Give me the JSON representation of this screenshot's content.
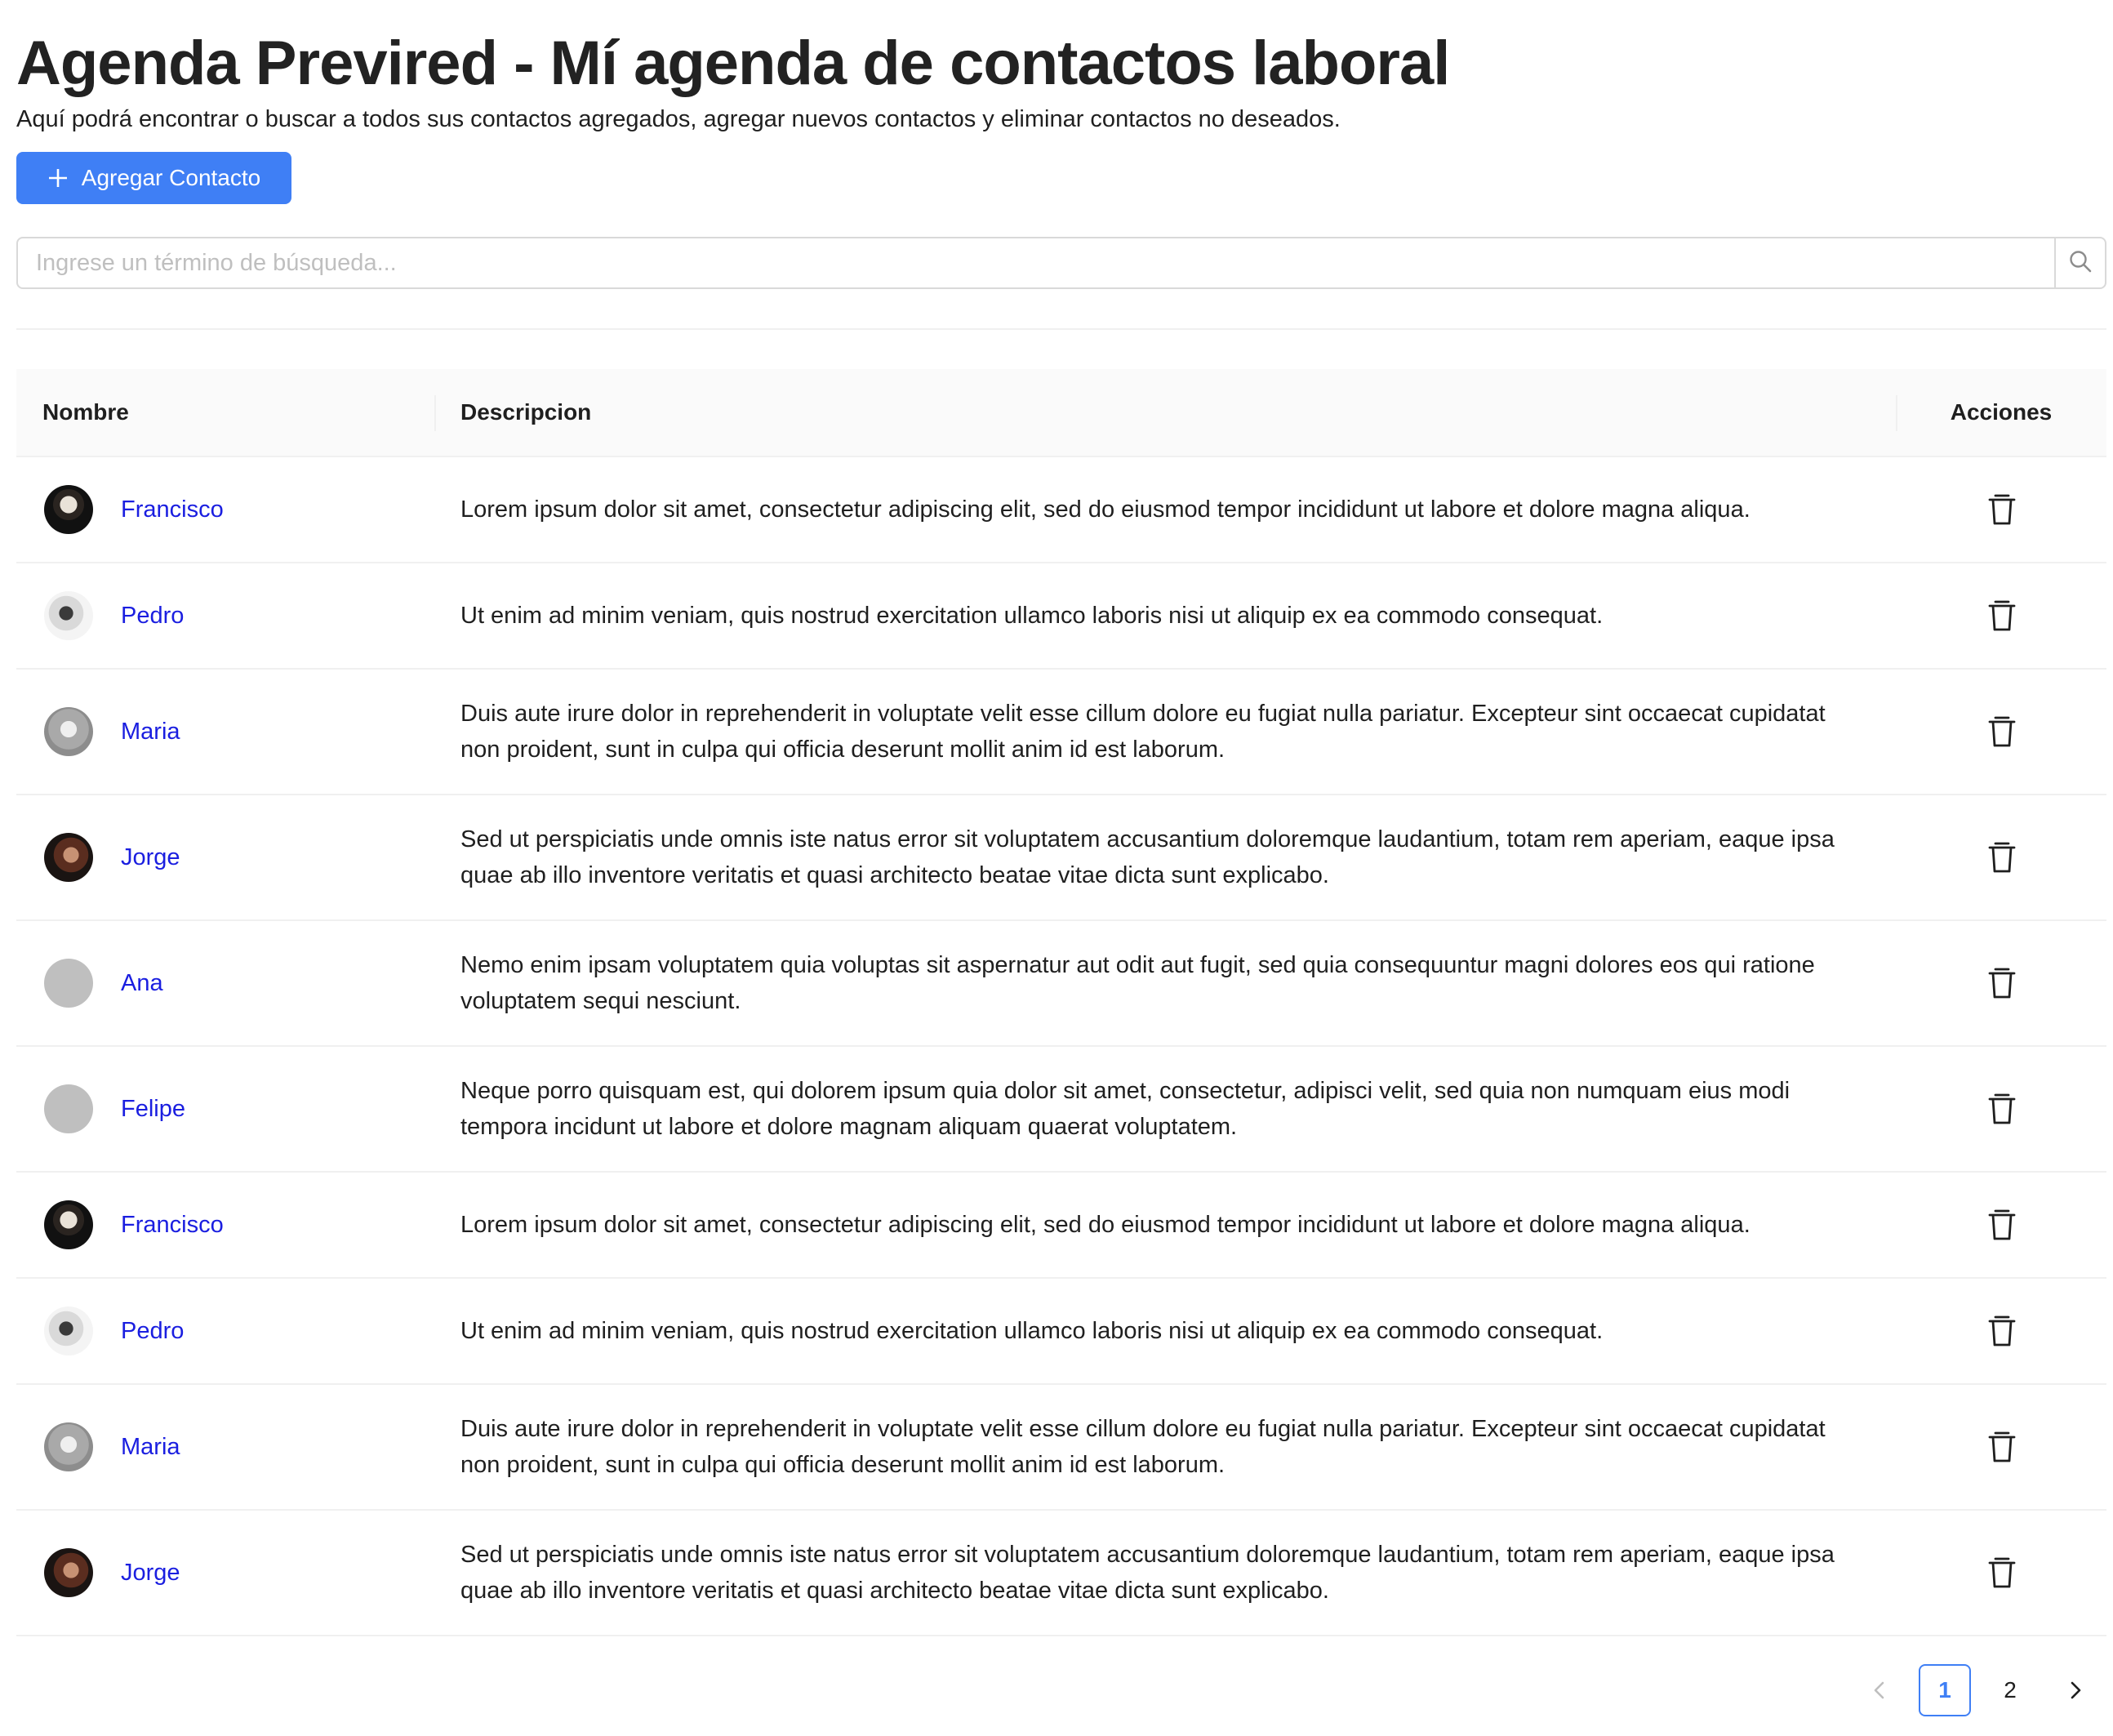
{
  "header": {
    "title": "Agenda Previred - Mí agenda de contactos laboral",
    "subtitle": "Aquí podrá encontrar o buscar a todos sus contactos agregados, agregar nuevos contactos y eliminar contactos no deseados."
  },
  "toolbar": {
    "add_label": "Agregar Contacto",
    "add_icon": "plus-icon"
  },
  "search": {
    "placeholder": "Ingrese un término de búsqueda...",
    "value": "",
    "icon": "search-icon"
  },
  "colors": {
    "accent": "#3f7ff5",
    "link": "#1a1ee0",
    "header_bg": "#fafafa",
    "border": "#f0f0f0"
  },
  "table": {
    "columns": [
      "Nombre",
      "Descripcion",
      "Acciones"
    ],
    "rows": [
      {
        "name": "Francisco",
        "avatar": "photo-dark",
        "description": "Lorem ipsum dolor sit amet, consectetur adipiscing elit, sed do eiusmod tempor incididunt ut labore et dolore magna aliqua.",
        "action_icon": "trash-icon"
      },
      {
        "name": "Pedro",
        "avatar": "photo-light",
        "description": "Ut enim ad minim veniam, quis nostrud exercitation ullamco laboris nisi ut aliquip ex ea commodo consequat.",
        "action_icon": "trash-icon"
      },
      {
        "name": "Maria",
        "avatar": "photo-gray",
        "description": "Duis aute irure dolor in reprehenderit in voluptate velit esse cillum dolore eu fugiat nulla pariatur. Excepteur sint occaecat cupidatat non proident, sunt in culpa qui officia deserunt mollit anim id est laborum.",
        "action_icon": "trash-icon"
      },
      {
        "name": "Jorge",
        "avatar": "photo-warm",
        "description": "Sed ut perspiciatis unde omnis iste natus error sit voluptatem accusantium doloremque laudantium, totam rem aperiam, eaque ipsa quae ab illo inventore veritatis et quasi architecto beatae vitae dicta sunt explicabo.",
        "action_icon": "trash-icon"
      },
      {
        "name": "Ana",
        "avatar": "placeholder",
        "description": "Nemo enim ipsam voluptatem quia voluptas sit aspernatur aut odit aut fugit, sed quia consequuntur magni dolores eos qui ratione voluptatem sequi nesciunt.",
        "action_icon": "trash-icon"
      },
      {
        "name": "Felipe",
        "avatar": "placeholder",
        "description": "Neque porro quisquam est, qui dolorem ipsum quia dolor sit amet, consectetur, adipisci velit, sed quia non numquam eius modi tempora incidunt ut labore et dolore magnam aliquam quaerat voluptatem.",
        "action_icon": "trash-icon"
      },
      {
        "name": "Francisco",
        "avatar": "photo-dark",
        "description": "Lorem ipsum dolor sit amet, consectetur adipiscing elit, sed do eiusmod tempor incididunt ut labore et dolore magna aliqua.",
        "action_icon": "trash-icon"
      },
      {
        "name": "Pedro",
        "avatar": "photo-light",
        "description": "Ut enim ad minim veniam, quis nostrud exercitation ullamco laboris nisi ut aliquip ex ea commodo consequat.",
        "action_icon": "trash-icon"
      },
      {
        "name": "Maria",
        "avatar": "photo-gray",
        "description": "Duis aute irure dolor in reprehenderit in voluptate velit esse cillum dolore eu fugiat nulla pariatur. Excepteur sint occaecat cupidatat non proident, sunt in culpa qui officia deserunt mollit anim id est laborum.",
        "action_icon": "trash-icon"
      },
      {
        "name": "Jorge",
        "avatar": "photo-warm",
        "description": "Sed ut perspiciatis unde omnis iste natus error sit voluptatem accusantium doloremque laudantium, totam rem aperiam, eaque ipsa quae ab illo inventore veritatis et quasi architecto beatae vitae dicta sunt explicabo.",
        "action_icon": "trash-icon"
      }
    ]
  },
  "pagination": {
    "prev_icon": "chevron-left-icon",
    "next_icon": "chevron-right-icon",
    "pages": [
      "1",
      "2"
    ],
    "current": "1"
  }
}
